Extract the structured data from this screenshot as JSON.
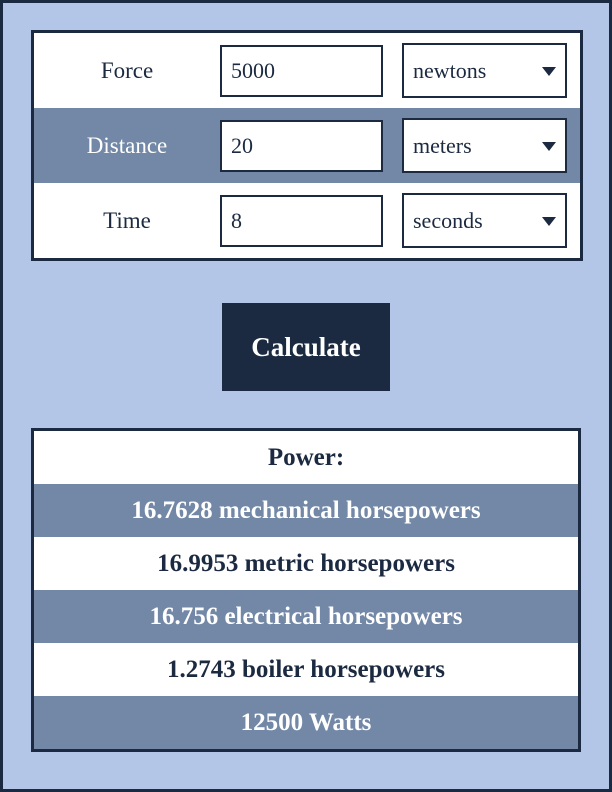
{
  "form": {
    "rows": [
      {
        "label": "Force",
        "value": "5000",
        "placeholder": "",
        "unit": "newtons",
        "arrow_icon": "chevron-down-icon"
      },
      {
        "label": "Distance",
        "value": "20",
        "placeholder": "",
        "unit": "meters",
        "arrow_icon": "chevron-down-icon"
      },
      {
        "label": "Time",
        "value": "8",
        "placeholder": "",
        "unit": "seconds",
        "arrow_icon": "chevron-down-icon"
      }
    ]
  },
  "actions": {
    "calculate_label": "Calculate"
  },
  "results": {
    "header": "Power:",
    "rows": [
      "16.7628 mechanical horsepowers",
      "16.9953 metric horsepowers",
      "16.756 electrical horsepowers",
      "1.2743 boiler horsepowers",
      "12500 Watts"
    ]
  },
  "colors": {
    "page_background": "#b3c6e7",
    "border_dark": "#1b2a41",
    "row_alt": "#7288a6",
    "row_base": "#ffffff",
    "button_background": "#1b2a41",
    "button_text": "#ffffff"
  }
}
